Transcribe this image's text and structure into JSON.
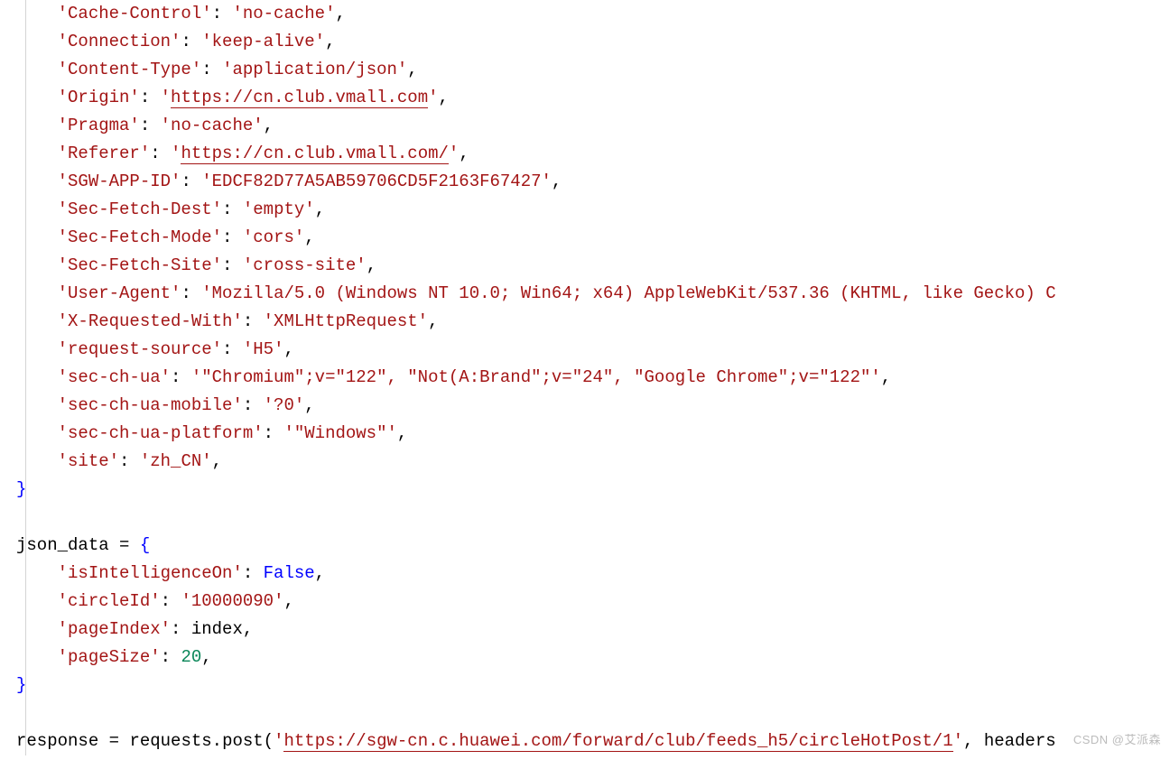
{
  "code": {
    "headers": [
      {
        "key": "'Cache-Control'",
        "sep": ": ",
        "val": "'no-cache'",
        "comma": ","
      },
      {
        "key": "'Connection'",
        "sep": ": ",
        "val": "'keep-alive'",
        "comma": ","
      },
      {
        "key": "'Content-Type'",
        "sep": ": ",
        "val": "'application/json'",
        "comma": ","
      },
      {
        "key": "'Origin'",
        "sep": ": ",
        "val_pre": "'",
        "url": "https://cn.club.vmall.com",
        "val_post": "'",
        "comma": ","
      },
      {
        "key": "'Pragma'",
        "sep": ": ",
        "val": "'no-cache'",
        "comma": ","
      },
      {
        "key": "'Referer'",
        "sep": ": ",
        "val_pre": "'",
        "url": "https://cn.club.vmall.com/",
        "val_post": "'",
        "comma": ","
      },
      {
        "key": "'SGW-APP-ID'",
        "sep": ": ",
        "val": "'EDCF82D77A5AB59706CD5F2163F67427'",
        "comma": ","
      },
      {
        "key": "'Sec-Fetch-Dest'",
        "sep": ": ",
        "val": "'empty'",
        "comma": ","
      },
      {
        "key": "'Sec-Fetch-Mode'",
        "sep": ": ",
        "val": "'cors'",
        "comma": ","
      },
      {
        "key": "'Sec-Fetch-Site'",
        "sep": ": ",
        "val": "'cross-site'",
        "comma": ","
      },
      {
        "key": "'User-Agent'",
        "sep": ": ",
        "val": "'Mozilla/5.0 (Windows NT 10.0; Win64; x64) AppleWebKit/537.36 (KHTML, like Gecko) C",
        "comma": ""
      },
      {
        "key": "'X-Requested-With'",
        "sep": ": ",
        "val": "'XMLHttpRequest'",
        "comma": ","
      },
      {
        "key": "'request-source'",
        "sep": ": ",
        "val": "'H5'",
        "comma": ","
      },
      {
        "key": "'sec-ch-ua'",
        "sep": ": ",
        "val": "'\"Chromium\";v=\"122\", \"Not(A:Brand\";v=\"24\", \"Google Chrome\";v=\"122\"'",
        "comma": ","
      },
      {
        "key": "'sec-ch-ua-mobile'",
        "sep": ": ",
        "val": "'?0'",
        "comma": ","
      },
      {
        "key": "'sec-ch-ua-platform'",
        "sep": ": ",
        "val": "'\"Windows\"'",
        "comma": ","
      },
      {
        "key": "'site'",
        "sep": ": ",
        "val": "'zh_CN'",
        "comma": ","
      }
    ],
    "close_brace": "}",
    "blank": "",
    "json_data_line": {
      "var": "json_data",
      "assign": " = ",
      "brace": "{"
    },
    "json_data_items": [
      {
        "key": "'isIntelligenceOn'",
        "sep": ": ",
        "kw": "False",
        "comma": ","
      },
      {
        "key": "'circleId'",
        "sep": ": ",
        "val": "'10000090'",
        "comma": ","
      },
      {
        "key": "'pageIndex'",
        "sep": ": ",
        "var": "index",
        "comma": ","
      },
      {
        "key": "'pageSize'",
        "sep": ": ",
        "num": "20",
        "comma": ","
      }
    ],
    "response_line": {
      "var": "response",
      "assign": " = ",
      "req": "requests",
      "dot": ".",
      "post": "post",
      "open": "(",
      "q1": "'",
      "url": "https://sgw-cn.c.huawei.com/forward/club/feeds_h5/circleHotPost/1",
      "q2": "'",
      "tail": ", headers"
    }
  },
  "watermark": "CSDN @艾派森"
}
